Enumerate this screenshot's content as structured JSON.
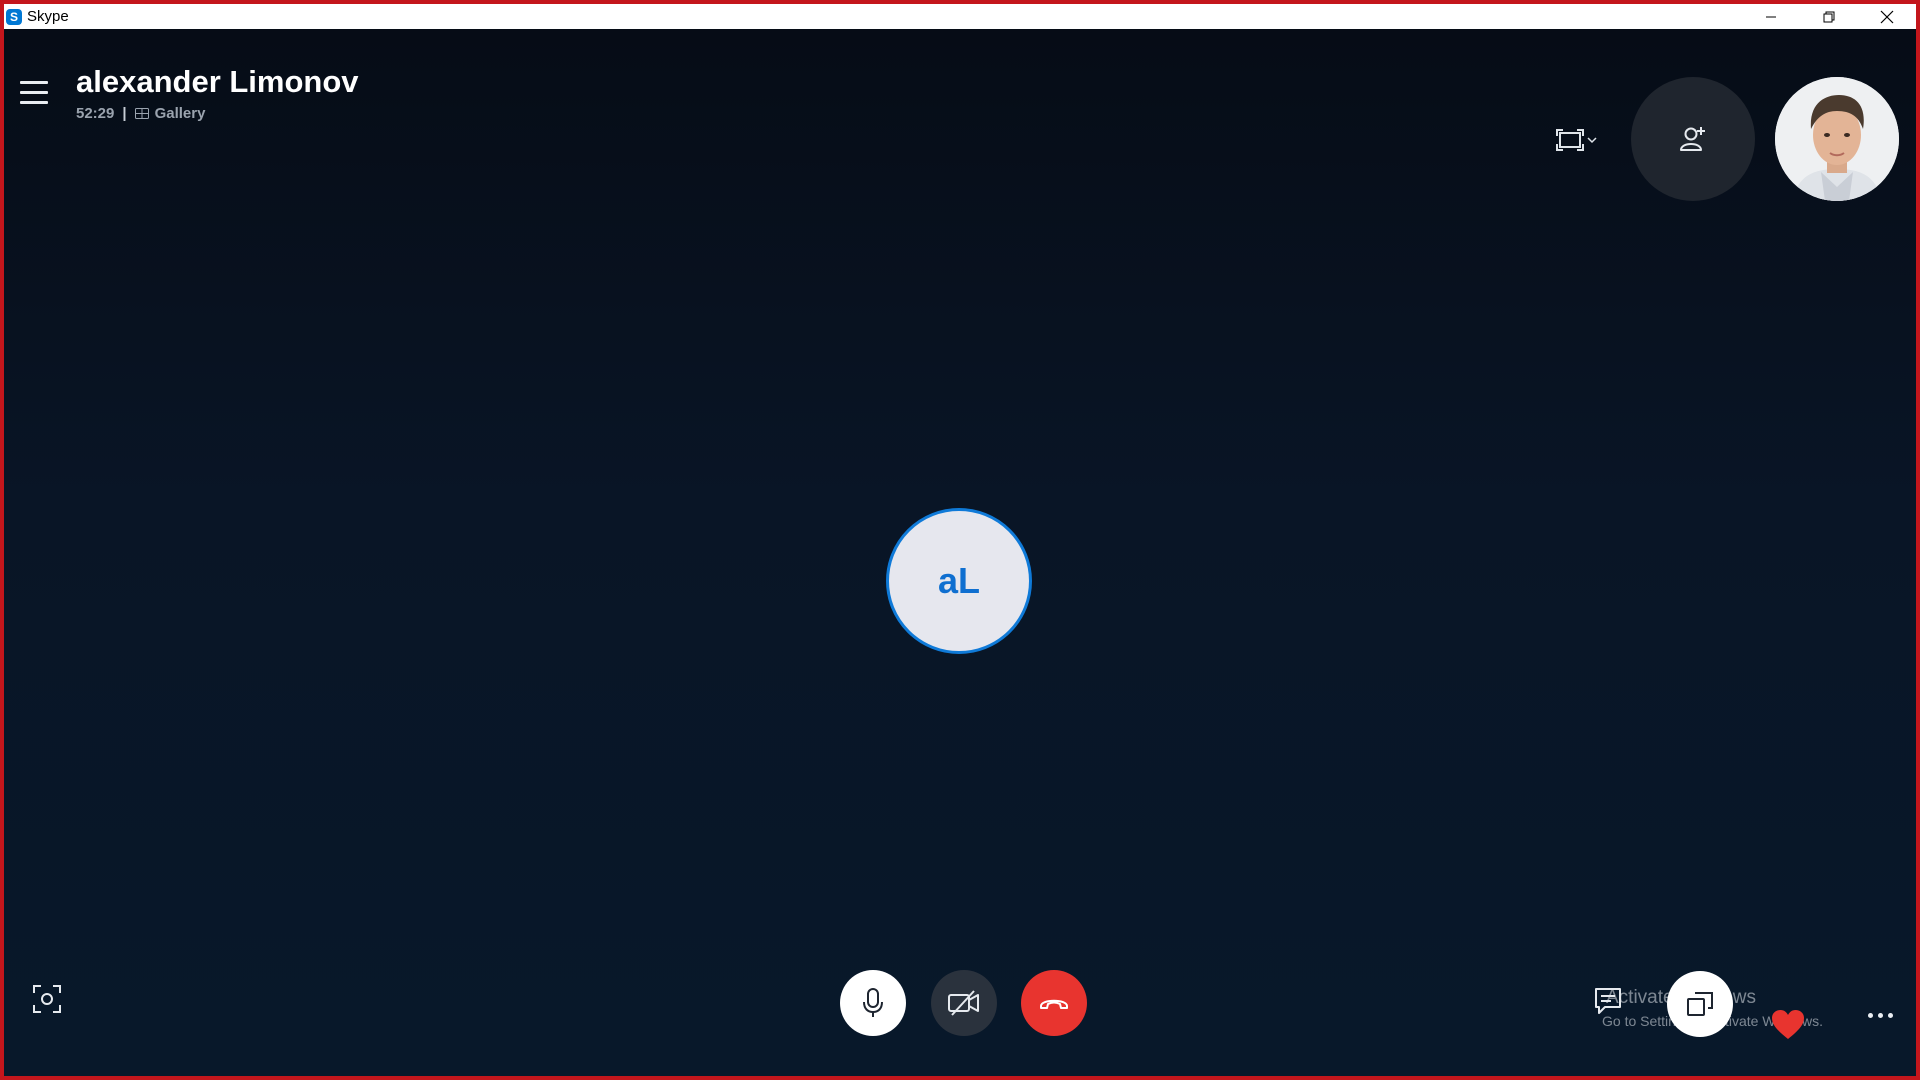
{
  "window": {
    "app_title": "Skype",
    "app_icon_glyph": "S",
    "accent_color": "#0078d4",
    "frame_color": "#c4161c",
    "controls": [
      {
        "name": "minimize-button",
        "icon": "minimize-icon"
      },
      {
        "name": "restore-button",
        "icon": "restore-icon"
      },
      {
        "name": "close-button",
        "icon": "close-icon"
      }
    ]
  },
  "call": {
    "contact_name": "alexander Limonov",
    "duration": "52:29",
    "separator": "|",
    "view_mode": "Gallery",
    "avatar_initials": "aL",
    "avatar_border_color": "#0f7ad8"
  },
  "header": {
    "menu_icon": "hamburger-menu-icon",
    "view_toggle_icon": "fullscreen-view-icon",
    "add_participant_icon": "add-person-icon",
    "self_preview_icon": "self-video-preview"
  },
  "toolbar": {
    "snapshot_icon": "snapshot-icon",
    "mic_icon": "microphone-icon",
    "video_icon": "video-off-icon",
    "end_call_icon": "end-call-icon",
    "end_call_color": "#e8342f",
    "chat_icon": "chat-icon",
    "share_icon": "share-screen-icon",
    "reaction_icon": "heart-icon",
    "reaction_color": "#e8342f",
    "more_icon": "more-options-icon"
  },
  "watermark": {
    "title": "Activate Windows",
    "subtitle": "Go to Settings to activate Windows."
  }
}
